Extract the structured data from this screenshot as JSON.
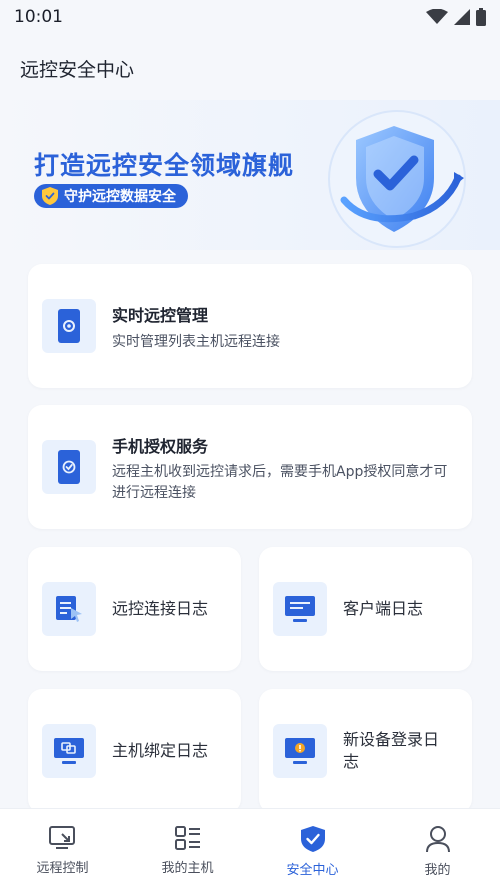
{
  "status_bar": {
    "time": "10:01"
  },
  "header": {
    "title": "远控安全中心"
  },
  "banner": {
    "title": "打造远控安全领域旗舰",
    "pill_text": "守护远控数据安全"
  },
  "cards": {
    "realtime": {
      "title": "实时远控管理",
      "desc": "实时管理列表主机远程连接"
    },
    "authorize": {
      "title": "手机授权服务",
      "desc": "远程主机收到远控请求后，需要手机App授权同意才可进行远程连接"
    },
    "remote_log": {
      "label": "远控连接日志"
    },
    "client_log": {
      "label": "客户端日志"
    },
    "bind_log": {
      "label": "主机绑定日志"
    },
    "new_device_log": {
      "label": "新设备登录日志"
    }
  },
  "tabs": [
    {
      "label": "远程控制",
      "icon": "remote-control-icon"
    },
    {
      "label": "我的主机",
      "icon": "my-hosts-icon"
    },
    {
      "label": "安全中心",
      "icon": "security-shield-icon",
      "active": true
    },
    {
      "label": "我的",
      "icon": "user-profile-icon"
    }
  ],
  "colors": {
    "accent": "#2b62d9",
    "icon_bg": "#e9f1fd",
    "page_bg": "#f5f7fb"
  }
}
